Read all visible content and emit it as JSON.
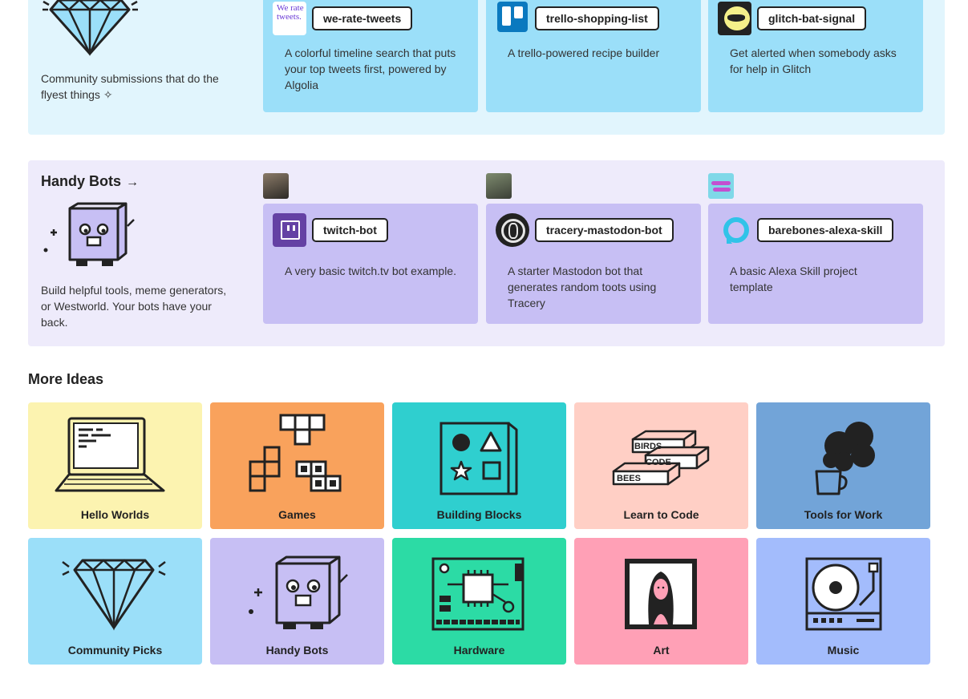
{
  "community": {
    "description": "Community submissions that do the flyest things ✧",
    "projects": [
      {
        "name": "we-rate-tweets",
        "description": "A colorful timeline search that puts your top tweets first, powered by Algolia",
        "avatar_text": "We rate tweets."
      },
      {
        "name": "trello-shopping-list",
        "description": "A trello-powered recipe builder"
      },
      {
        "name": "glitch-bat-signal",
        "description": "Get alerted when somebody asks for help in Glitch"
      }
    ]
  },
  "handy_bots": {
    "title": "Handy Bots",
    "arrow": "→",
    "description": "Build helpful tools, meme generators, or Westworld. Your bots have your back.",
    "projects": [
      {
        "name": "twitch-bot",
        "description": "A very basic twitch.tv bot example."
      },
      {
        "name": "tracery-mastodon-bot",
        "description": "A starter Mastodon bot that generates random toots using Tracery"
      },
      {
        "name": "barebones-alexa-skill",
        "description": "A basic Alexa Skill project  template"
      }
    ]
  },
  "more_ideas": {
    "title": "More Ideas",
    "items": [
      {
        "label": "Hello Worlds",
        "color": "#fcf3b0"
      },
      {
        "label": "Games",
        "color": "#f9a25c"
      },
      {
        "label": "Building Blocks",
        "color": "#2fcfcf"
      },
      {
        "label": "Learn to Code",
        "color": "#ffcfc5",
        "illus_labels": [
          "BIRDS",
          "CODE",
          "BEES"
        ]
      },
      {
        "label": "Tools for Work",
        "color": "#72a4d8"
      },
      {
        "label": "Community Picks",
        "color": "#9bdff9"
      },
      {
        "label": "Handy Bots",
        "color": "#c7bff4"
      },
      {
        "label": "Hardware",
        "color": "#2cdba5"
      },
      {
        "label": "Art",
        "color": "#ffa0b6"
      },
      {
        "label": "Music",
        "color": "#a3bcfc"
      }
    ]
  },
  "colors": {
    "community_bg": "#e1f5fd",
    "community_card": "#9bdff9",
    "bots_bg": "#eeebfb",
    "bots_card": "#c7bff4"
  }
}
